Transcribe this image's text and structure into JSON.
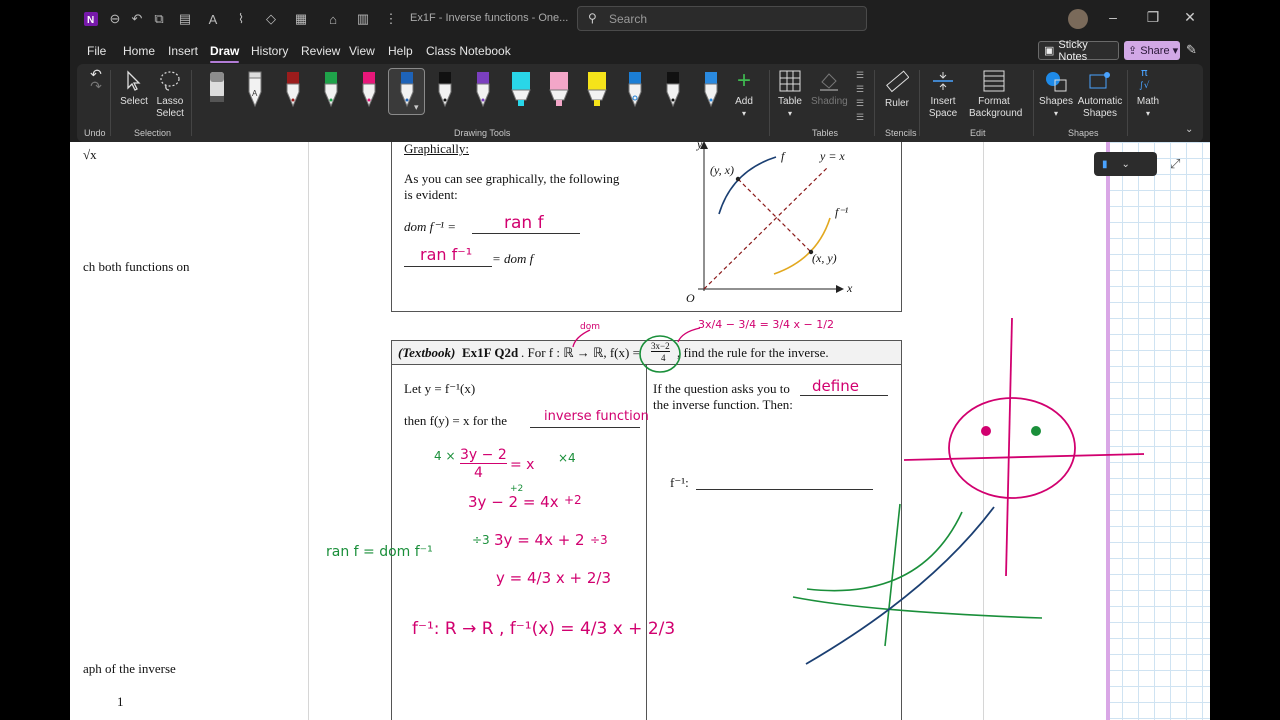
{
  "titlebar": {
    "document_title": "Ex1F - Inverse functions  -  One...",
    "search_placeholder": "Search"
  },
  "menu": {
    "items": [
      "File",
      "Home",
      "Insert",
      "Draw",
      "History",
      "Review",
      "View",
      "Help",
      "Class Notebook"
    ],
    "active": "Draw",
    "sticky_notes": "Sticky Notes",
    "share": "Share"
  },
  "ribbon": {
    "undo_label": "Undo",
    "select_label": "Select",
    "lasso_label": "Lasso Select",
    "selection_group": "Selection",
    "drawing_tools_group": "Drawing Tools",
    "add_label": "Add",
    "table_label": "Table",
    "shading_label": "Shading",
    "tables_group": "Tables",
    "ruler_label": "Ruler",
    "stencils_group": "Stencils",
    "insert_space_label": "Insert Space",
    "format_background_label": "Format Background",
    "edit_group": "Edit",
    "shapes_label": "Shapes",
    "automatic_shapes_label": "Automatic Shapes",
    "math_label": "Math",
    "shapes_group": "Shapes",
    "pens": [
      {
        "name": "pencil-gray",
        "color": "#8c8c8c"
      },
      {
        "name": "pen-white",
        "color": "#ffffff"
      },
      {
        "name": "pen-darkred",
        "color": "#9b1c1c"
      },
      {
        "name": "pen-green",
        "color": "#1fa34a"
      },
      {
        "name": "pen-pink",
        "color": "#e8177a"
      },
      {
        "name": "pen-blue-selected",
        "color": "#1e63b8"
      },
      {
        "name": "pen-black",
        "color": "#111111"
      },
      {
        "name": "pen-purple",
        "color": "#7b3fbf"
      },
      {
        "name": "highlighter-cyan",
        "color": "#29d6e8"
      },
      {
        "name": "highlighter-pink",
        "color": "#f3a6c8"
      },
      {
        "name": "highlighter-yellow",
        "color": "#f5e31a"
      },
      {
        "name": "pen-blue-2",
        "color": "#1b7ed6"
      },
      {
        "name": "pen-black-2",
        "color": "#111111"
      },
      {
        "name": "pen-blue-3",
        "color": "#2a8ae0"
      }
    ]
  },
  "side_text": {
    "line1": "√x",
    "line2": "ch both functions on",
    "line3": "aph of the inverse",
    "line4": "1"
  },
  "box1": {
    "heading": "Graphically:",
    "line1": "As you can see graphically, the following",
    "line2": "is evident:",
    "dom_label": "dom f⁻¹ =",
    "dom_answer": "ran f",
    "ran_answer": "ran f⁻¹",
    "dom_rhs": "= dom f",
    "graph": {
      "y_axis": "y",
      "x_axis": "x",
      "origin": "O",
      "f_label": "f",
      "finv_label": "f⁻¹",
      "line_label": "y = x",
      "point1": "(y, x)",
      "point2": "(x, y)"
    }
  },
  "box2": {
    "header_prefix": "(Textbook)",
    "header_ex": "Ex1F Q2d",
    "header_mid": ". For f : ℝ → ℝ, f(x) =",
    "header_frac_num": "3x−2",
    "header_frac_den": "4",
    "header_suffix": ", find the rule for the inverse.",
    "left_line1": "Let y = f⁻¹(x)",
    "left_line2": "then f(y) = x  for  the",
    "left_answer": "inverse function",
    "right_line1": "If the question asks you to",
    "right_answer": "define",
    "right_line2": "the inverse function. Then:",
    "right_finv": "f⁻¹:"
  },
  "ink": {
    "dom_note": "dom",
    "top_expansion": "3x/4 − 3/4 = 3/4 x − 1/2",
    "step1_lhs": "3y − 2",
    "step1_den": "4",
    "step1_rhs": "= x",
    "step1_mul": "×4",
    "step1_pre": "4 ×",
    "step2": "3y − 2 = 4x",
    "step2_op": "+2",
    "step2_small": "+2",
    "step3": "3y = 4x + 2",
    "step3_op": "÷3",
    "step3_pre": "÷3",
    "step4": "y = 4/3 x + 2/3",
    "final": "f⁻¹: R → R ,  f⁻¹(x) = 4/3 x + 2/3",
    "ranf_note": "ran f = dom f⁻¹"
  }
}
